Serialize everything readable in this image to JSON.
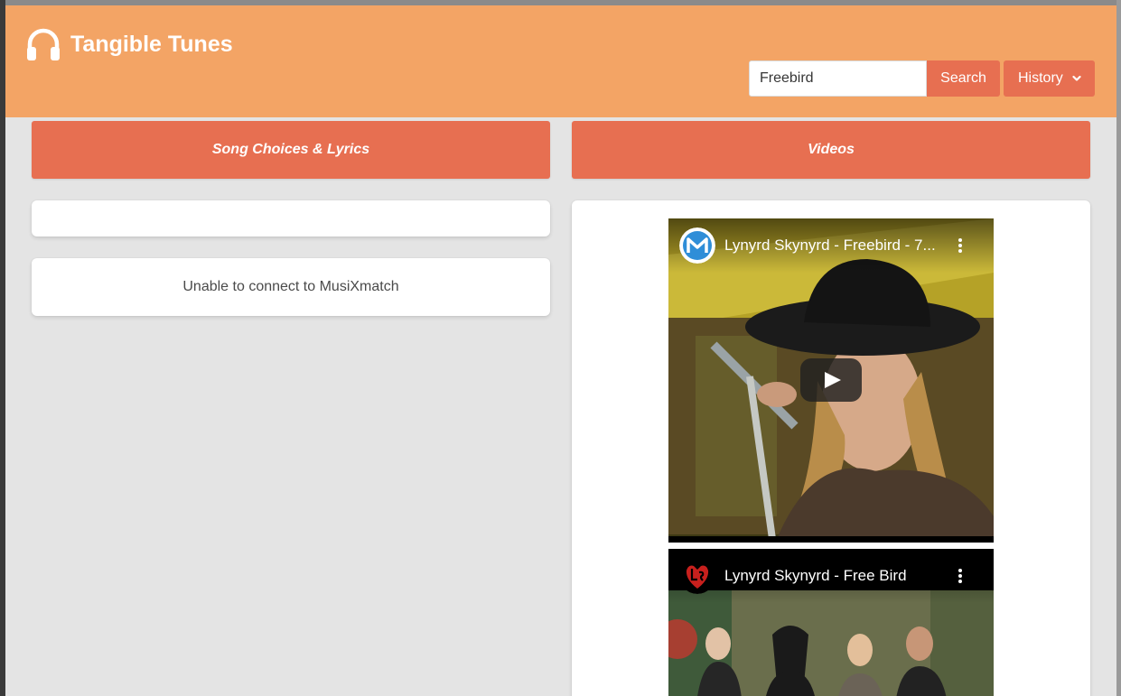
{
  "app": {
    "title": "Tangible Tunes",
    "brand_icon": "headphones-icon"
  },
  "search": {
    "value": "Freebird",
    "button_label": "Search"
  },
  "history": {
    "label": "History",
    "icon": "chevron-down-icon"
  },
  "columns": {
    "left_heading": "Song Choices & Lyrics",
    "right_heading": "Videos"
  },
  "lyrics": {
    "song_choices_text": "",
    "message": "Unable to connect to MusiXmatch"
  },
  "videos": [
    {
      "title": "Lynyrd Skynyrd - Freebird - 7...",
      "channel_icon": "m-logo-icon",
      "play_icon": "play-icon",
      "menu_icon": "more-vert-icon"
    },
    {
      "title": "Lynyrd Skynyrd - Free Bird",
      "channel_icon": "ls-logo-icon",
      "menu_icon": "more-vert-icon"
    }
  ],
  "colors": {
    "header": "#f3a465",
    "accent": "#e76f51",
    "page_background": "#e4e4e4"
  }
}
